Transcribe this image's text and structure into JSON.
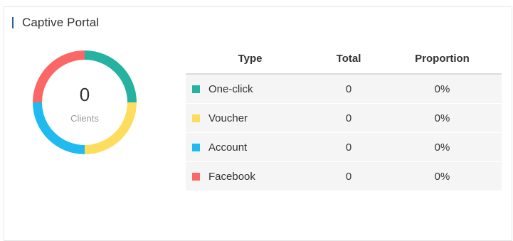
{
  "panel": {
    "title": "Captive Portal"
  },
  "donut": {
    "value": "0",
    "label": "Clients",
    "segments": [
      {
        "name": "One-click",
        "fraction": 0.25,
        "color": "#26b2a1"
      },
      {
        "name": "Voucher",
        "fraction": 0.25,
        "color": "#fedc5d"
      },
      {
        "name": "Account",
        "fraction": 0.25,
        "color": "#1fbaf0"
      },
      {
        "name": "Facebook",
        "fraction": 0.25,
        "color": "#fb6767"
      }
    ]
  },
  "table": {
    "headers": {
      "type": "Type",
      "total": "Total",
      "proportion": "Proportion"
    },
    "rows": [
      {
        "type": "One-click",
        "total": "0",
        "proportion": "0%",
        "color": "#26b2a1"
      },
      {
        "type": "Voucher",
        "total": "0",
        "proportion": "0%",
        "color": "#fedc5d"
      },
      {
        "type": "Account",
        "total": "0",
        "proportion": "0%",
        "color": "#1fbaf0"
      },
      {
        "type": "Facebook",
        "total": "0",
        "proportion": "0%",
        "color": "#fb6767"
      }
    ]
  }
}
